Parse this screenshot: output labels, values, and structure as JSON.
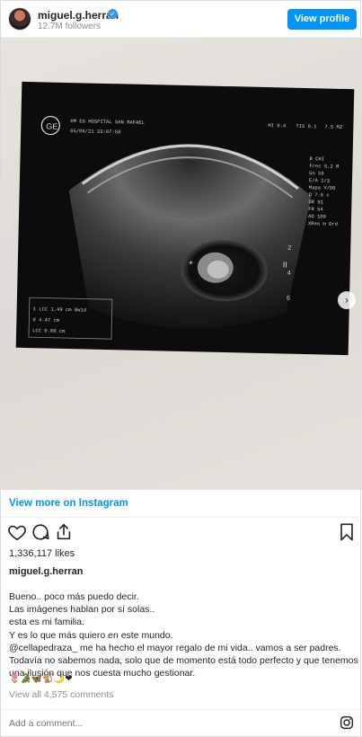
{
  "header": {
    "username": "miguel.g.herran",
    "followers": "12.7M followers",
    "view_profile_label": "View profile",
    "verified_icon": "verified-badge-icon"
  },
  "media": {
    "slide_count": 7,
    "active_slide": 1,
    "next_icon": "chevron-right-icon",
    "scan_text": {
      "hospital": "HM EG HOSPITAL SAN RAFAEL",
      "date": "05/06/21 23:07:58",
      "readout_right": [
        "MI 0.4",
        "TIS 0.1",
        "7.5 MZ"
      ],
      "params": [
        "B   CHI",
        "Frec  5.2 M",
        "Gn   58",
        "E/A  2/3",
        "Mapa  V/D0",
        "D   7.6 c",
        "DR   91",
        "FR   54",
        "AO   100",
        "XBea  m Ord"
      ],
      "measure_rows": [
        "1 LCC  1.49 cm  8w1d",
        "d    4.47 cm",
        "LCC  0.00 cm"
      ]
    }
  },
  "links": {
    "view_more": "View more on Instagram"
  },
  "actions": {
    "like_icon": "heart-icon",
    "comment_icon": "comment-icon",
    "share_icon": "share-icon",
    "save_icon": "bookmark-icon"
  },
  "post": {
    "likes": "1,336,117 likes",
    "caption_user": "miguel.g.herran",
    "caption_lines": [
      "Bueno.. poco más puedo decir.",
      "Las imágenes hablan por sí solas..",
      "esta es mi familia.",
      "Y es lo que más quiero en este mundo.",
      "@cellapedraza_ me ha hecho el mayor regalo de mi vida.. vamos a ser padres.",
      "Todavía no sabemos nada, solo que de momento está todo perfecto y que tenemos",
      "una ilusión que nos cuesta mucho gestionar."
    ],
    "emojis": "🌷🐊🦋🐒🌙❤",
    "view_all_comments": "View all 4,575 comments"
  },
  "comment_box": {
    "placeholder": "Add a comment...",
    "instagram_icon": "instagram-logo-icon"
  },
  "colors": {
    "accent": "#0095f6",
    "text": "#262626",
    "muted": "#8e8e8e"
  }
}
